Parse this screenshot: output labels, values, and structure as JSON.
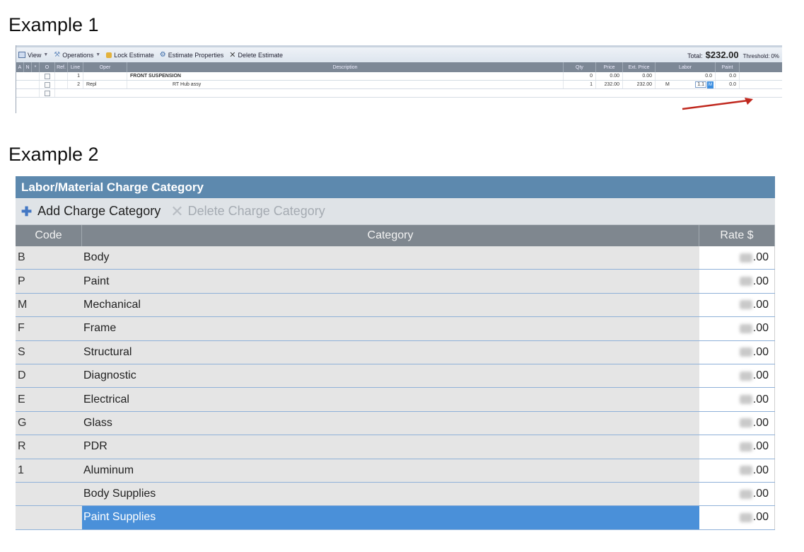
{
  "example1": {
    "heading": "Example 1",
    "toolbar": {
      "view_label": "View",
      "operations_label": "Operations",
      "lock_label": "Lock Estimate",
      "properties_label": "Estimate Properties",
      "delete_label": "Delete Estimate",
      "total_label": "Total:",
      "total_value": "$232.00",
      "threshold_label": "Threshold:",
      "threshold_value": "0%"
    },
    "columns": [
      "A",
      "N",
      "*",
      "O",
      "Ref.",
      "Line",
      "Oper",
      "Description",
      "Qty",
      "Price",
      "Ext. Price",
      "Labor",
      "Paint"
    ],
    "rows": [
      {
        "line": "1",
        "oper": "",
        "description": "FRONT SUSPENSION",
        "qty": "0",
        "price": "0.00",
        "ext_price": "0.00",
        "labor_type": "",
        "labor": "0.0",
        "paint": "0.0"
      },
      {
        "line": "2",
        "oper": "Repl",
        "description": "RT Hub assy",
        "qty": "1",
        "price": "232.00",
        "ext_price": "232.00",
        "labor_type": "M",
        "labor": "1.1",
        "labor_chip": "M",
        "paint": "0.0"
      }
    ]
  },
  "example2": {
    "heading": "Example 2",
    "title": "Labor/Material Charge Category",
    "add_label": "Add Charge Category",
    "delete_label": "Delete Charge Category",
    "columns": {
      "code": "Code",
      "category": "Category",
      "rate": "Rate $"
    },
    "rows": [
      {
        "code": "B",
        "category": "Body",
        "rate_suffix": ".00"
      },
      {
        "code": "P",
        "category": "Paint",
        "rate_suffix": ".00"
      },
      {
        "code": "M",
        "category": "Mechanical",
        "rate_suffix": ".00"
      },
      {
        "code": "F",
        "category": "Frame",
        "rate_suffix": ".00"
      },
      {
        "code": "S",
        "category": "Structural",
        "rate_suffix": ".00"
      },
      {
        "code": "D",
        "category": "Diagnostic",
        "rate_suffix": ".00"
      },
      {
        "code": "E",
        "category": "Electrical",
        "rate_suffix": ".00"
      },
      {
        "code": "G",
        "category": "Glass",
        "rate_suffix": ".00"
      },
      {
        "code": "R",
        "category": "PDR",
        "rate_suffix": ".00"
      },
      {
        "code": "1",
        "category": "Aluminum",
        "rate_suffix": ".00"
      },
      {
        "code": "",
        "category": "Body Supplies",
        "rate_suffix": ".00"
      },
      {
        "code": "",
        "category": "Paint Supplies",
        "rate_suffix": ".00",
        "selected": true
      }
    ]
  }
}
